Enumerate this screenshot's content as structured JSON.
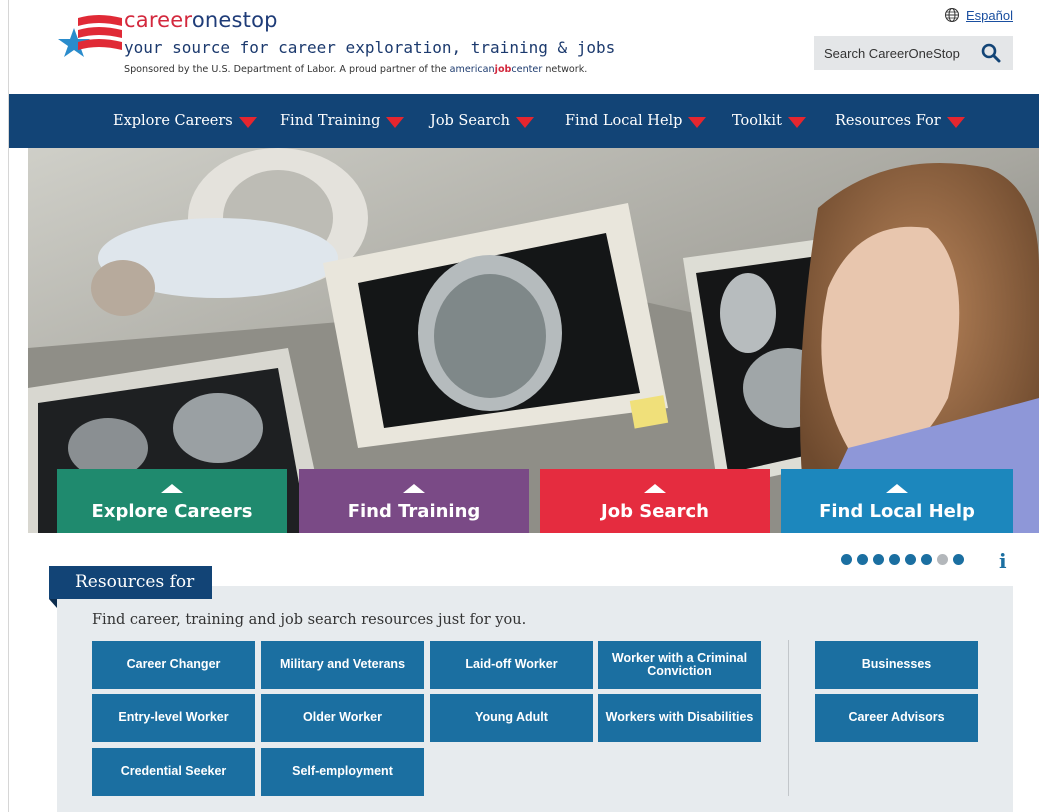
{
  "brand": {
    "name_part1": "career",
    "name_part2": "onestop",
    "tagline": "your source for career exploration, training & jobs",
    "sponsor_prefix": "Sponsored by the U.S. Department of Labor. A proud partner of the ",
    "sponsor_ajc_1": "american",
    "sponsor_ajc_2": "job",
    "sponsor_ajc_3": "center",
    "sponsor_suffix": " network."
  },
  "header": {
    "language_link": "Español",
    "search_placeholder": "Search CareerOneStop"
  },
  "nav": {
    "items": [
      {
        "label": "Explore Careers"
      },
      {
        "label": "Find Training"
      },
      {
        "label": "Job Search"
      },
      {
        "label": "Find Local Help"
      },
      {
        "label": "Toolkit"
      },
      {
        "label": "Resources For"
      }
    ]
  },
  "hero": {
    "tiles": [
      {
        "label": "Explore Careers",
        "color": "#1f8a6e"
      },
      {
        "label": "Find Training",
        "color": "#7a4a86"
      },
      {
        "label": "Job Search",
        "color": "#e52c3f"
      },
      {
        "label": "Find Local Help",
        "color": "#1c87bd"
      }
    ],
    "carousel": {
      "total": 8,
      "active_indicator": "7 of 8 filled dots pattern"
    }
  },
  "resources": {
    "tab_label": "Resources for",
    "intro": "Find career, training and job search resources just for you.",
    "buttons": [
      "Career Changer",
      "Military and Veterans",
      "Laid-off Worker",
      "Worker with a Criminal Conviction",
      "Entry-level Worker",
      "Older Worker",
      "Young Adult",
      "Workers with Disabilities",
      "Credential Seeker",
      "Self-employment"
    ],
    "side_buttons": [
      "Businesses",
      "Career Advisors"
    ]
  },
  "colors": {
    "nav_bg": "#124476",
    "nav_arrow": "#e5262f",
    "resource_button": "#1b6fa1",
    "resource_panel": "#e7ebee",
    "brand_red": "#d3283d",
    "brand_blue": "#1f3c78"
  },
  "icons": {
    "language": "globe-icon",
    "search": "search-icon",
    "info": "info-icon"
  }
}
